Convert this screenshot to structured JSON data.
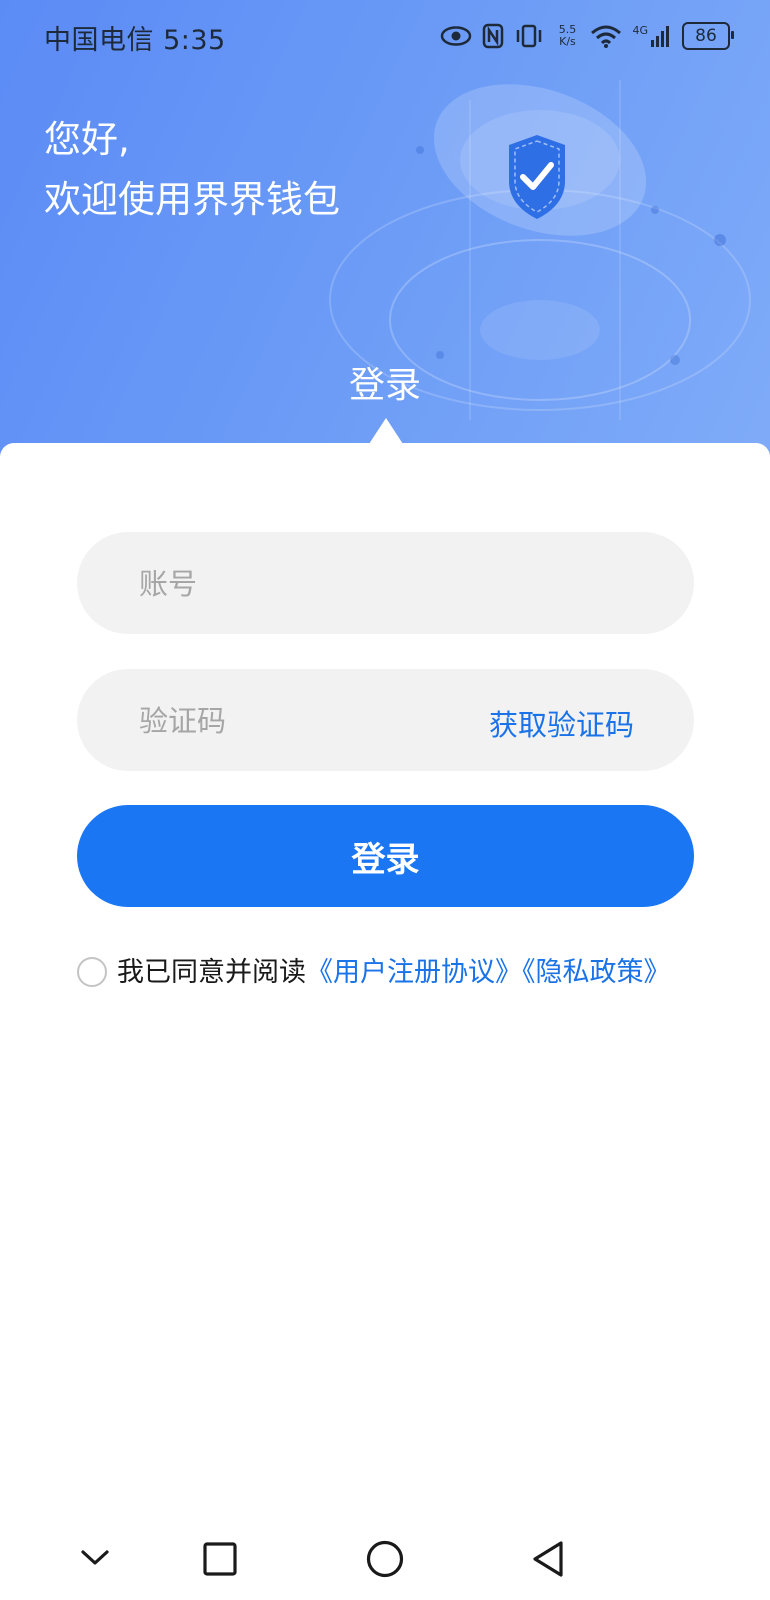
{
  "status_bar": {
    "carrier_time": "中国电信 5:35",
    "net_speed_value": "5.5",
    "net_speed_unit": "K/s",
    "network": "4G",
    "battery": "86"
  },
  "hero": {
    "greeting_line1": "您好,",
    "greeting_line2": "欢迎使用界界钱包",
    "active_tab": "登录"
  },
  "form": {
    "account_placeholder": "账号",
    "code_placeholder": "验证码",
    "get_code_label": "获取验证码",
    "login_label": "登录"
  },
  "agreement": {
    "prefix": "我已同意并阅读",
    "user_agreement": "《用户注册协议》",
    "privacy_policy": "《隐私政策》",
    "checked": false
  },
  "colors": {
    "primary": "#1a76f3",
    "link": "#1a73e8",
    "hero_gradient_start": "#5b8bf5",
    "hero_gradient_end": "#7fabf8"
  }
}
